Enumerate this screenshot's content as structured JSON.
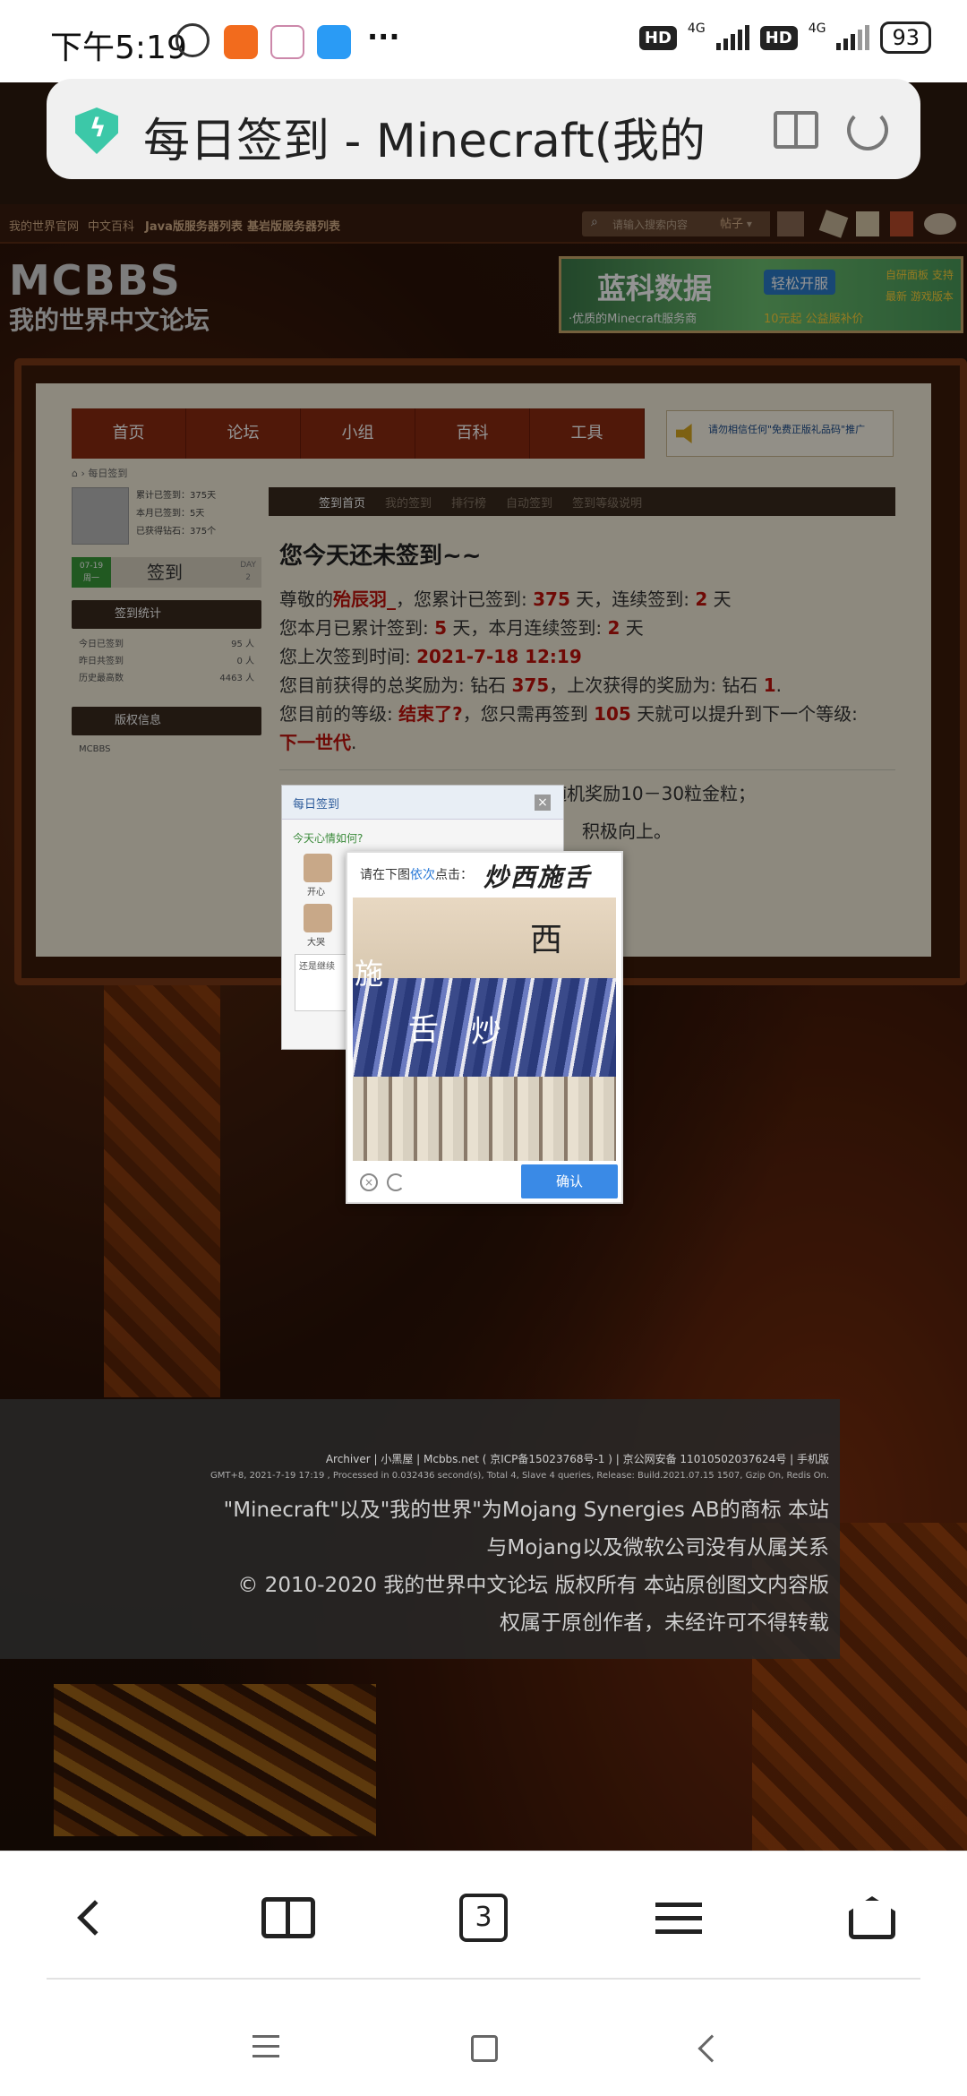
{
  "status_bar": {
    "time": "下午5:19",
    "signal1": "4G",
    "signal2": "4G",
    "hd1": "HD",
    "hd2": "HD",
    "battery": "93",
    "more": "···"
  },
  "browser": {
    "url_title": "每日签到 - Minecraft(我的",
    "tab_count": "3"
  },
  "site": {
    "topnav": [
      "我的世界官网",
      "中文百科",
      "Java版服务器列表",
      "基岩版服务器列表"
    ],
    "search_placeholder": "请输入搜索内容",
    "search_type": "帖子",
    "logo_en": "MCBBS",
    "logo_cn": "我的世界中文论坛",
    "ad": {
      "title": "蓝科数据",
      "badge": "轻松开服",
      "sub": "·优质的Minecraft服务商",
      "price": "10元起 公益服补价",
      "right": "自研面板 支持最新 游戏版本"
    },
    "mainnav": [
      "首页",
      "论坛",
      "小组",
      "百科",
      "工具"
    ],
    "notice": "请勿相信任何\"免费正版礼品码\"推广",
    "breadcrumb": "每日签到",
    "user_stats": [
      "累计已签到：375天",
      "本月已签到：5天",
      "已获得钻石：375个"
    ],
    "sign_date": "07-19",
    "sign_weekday": "周一",
    "sign_button": "签到",
    "sign_day_label": "DAY",
    "sign_day": "2",
    "stats_title": "签到统计",
    "stats": [
      {
        "label": "今日已签到",
        "value": "95 人"
      },
      {
        "label": "昨日共签到",
        "value": "0 人"
      },
      {
        "label": "历史最高数",
        "value": "4463 人"
      }
    ],
    "copyright_title": "版权信息",
    "copyright_text": "MCBBS",
    "subtabs": [
      "签到首页",
      "我的签到",
      "排行榜",
      "自动签到",
      "签到等级说明"
    ],
    "heading": "您今天还未签到~~",
    "info": {
      "l1a": "尊敬的",
      "user": "殆辰羽_",
      "l1b": "，您累计已签到:",
      "total": "375",
      "l1c": "天，连续签到:",
      "streak": "2",
      "l1d": "天",
      "l2a": "您本月已累计签到:",
      "month": "5",
      "l2b": "天，本月连续签到:",
      "mstreak": "2",
      "l2c": "天",
      "l3a": "您上次签到时间:",
      "last_time": "2021-7-18 12:19",
      "l4a": "您目前获得的总奖励为: 钻石",
      "reward": "375",
      "l4b": "，上次获得的奖励为: 钻石",
      "last_reward": "1",
      "l4c": ".",
      "l5a": "您目前的等级:",
      "level": "结束了?",
      "l5b": "，您只需再签到",
      "need": "105",
      "l5c": "天就可以提升到下一个等级:",
      "next_level": "下一世代",
      "l6": "."
    },
    "rules_visible": [
      "1、奖励措施：1颗钻石，Lv6以上随机奖励10－30粒金粒；",
      "积极向上。"
    ]
  },
  "sign_dialog": {
    "title": "每日签到",
    "prompt": "今天心情如何?",
    "moods": [
      "开心",
      "大哭"
    ],
    "textarea": "还是继续"
  },
  "captcha": {
    "prompt_a": "请在下图",
    "prompt_b": "依次",
    "prompt_c": "点击：",
    "target": "炒西施舌",
    "chars": [
      "西",
      "施",
      "舌",
      "炒"
    ],
    "confirm": "确认"
  },
  "footer": {
    "links": "Archiver | 小黑屋 | Mcbbs.net ( 京ICP备15023768号-1 ) | 京公网安备 11010502037624号 | 手机版",
    "meta": "GMT+8, 2021-7-19 17:19 , Processed in 0.032436 second(s), Total 4, Slave 4 queries, Release: Build.2021.07.15 1507, Gzip On, Redis On.",
    "l1": "\"Minecraft\"以及\"我的世界\"为Mojang Synergies AB的商标 本站",
    "l2": "与Mojang以及微软公司没有从属关系",
    "l3": "© 2010-2020 我的世界中文论坛 版权所有 本站原创图文内容版",
    "l4": "权属于原创作者，未经许可不得转载"
  },
  "colors": {
    "accent_red": "#c0120c",
    "nav_red": "#8a2a10",
    "confirm_blue": "#3a8ae6"
  }
}
